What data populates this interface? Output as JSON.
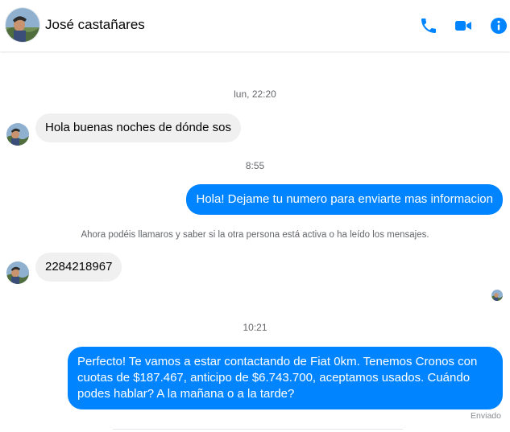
{
  "header": {
    "contact_name": "José castañares",
    "icons": [
      "phone-icon",
      "video-camera-icon",
      "info-icon"
    ],
    "accent_color": "#0084ff"
  },
  "messages": [
    {
      "type": "timestamp",
      "text": "lun, 22:20"
    },
    {
      "type": "incoming",
      "text": "Hola buenas noches de dónde sos"
    },
    {
      "type": "timestamp",
      "text": "8:55"
    },
    {
      "type": "outgoing",
      "text": "Hola! Dejame tu numero para enviarte mas informacion"
    },
    {
      "type": "notice",
      "text": "Ahora podéis llamaros y saber si la otra persona está activa o ha leído los mensajes."
    },
    {
      "type": "incoming",
      "text": "2284218967"
    },
    {
      "type": "timestamp",
      "text": "10:21"
    },
    {
      "type": "outgoing",
      "text": "Perfecto! Te vamos a estar contactando de Fiat 0km. Tenemos Cronos con cuotas de $187.467, anticipo de $6.743.700, aceptamos usados. Cuándo podes hablar? A la mañana o a la tarde?"
    }
  ],
  "status": {
    "delivery": "Enviado"
  }
}
